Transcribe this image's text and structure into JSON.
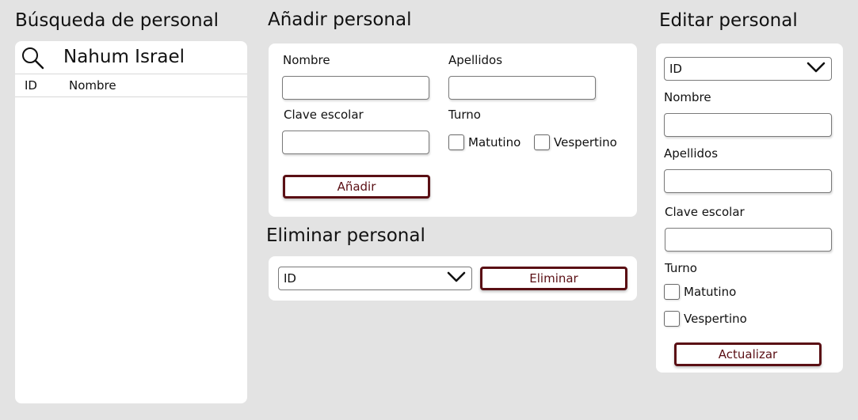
{
  "search": {
    "title": "Búsqueda de personal",
    "query": "Nahum Israel",
    "columns": [
      "ID",
      "Nombre"
    ]
  },
  "add": {
    "title": "Añadir personal",
    "nombre_label": "Nombre",
    "apellidos_label": "Apellidos",
    "clave_label": "Clave escolar",
    "turno_label": "Turno",
    "matutino_label": "Matutino",
    "vespertino_label": "Vespertino",
    "button_label": "Añadir"
  },
  "delete": {
    "title": "Eliminar personal",
    "select_value": "ID",
    "button_label": "Eliminar"
  },
  "edit": {
    "title": "Editar personal",
    "select_value": "ID",
    "nombre_label": "Nombre",
    "apellidos_label": "Apellidos",
    "clave_label": "Clave escolar",
    "turno_label": "Turno",
    "matutino_label": "Matutino",
    "vespertino_label": "Vespertino",
    "button_label": "Actualizar"
  },
  "colors": {
    "background": "#e3e3e3",
    "panel": "#ffffff",
    "accent": "#5a0f14"
  }
}
